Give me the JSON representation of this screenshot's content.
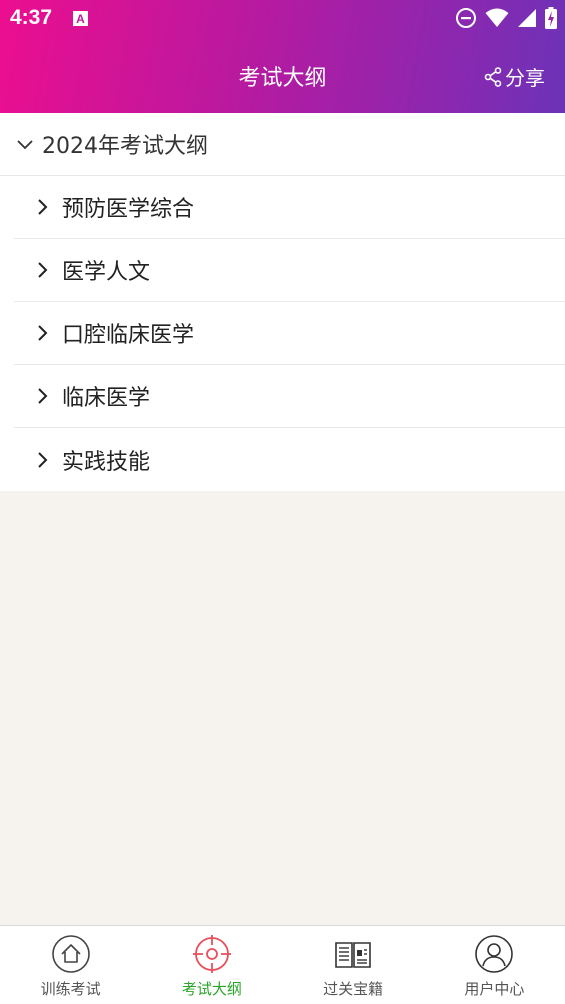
{
  "status": {
    "time": "4:37"
  },
  "header": {
    "title": "考试大纲",
    "share_label": "分享"
  },
  "outline": {
    "group_title": "2024年考试大纲",
    "items": [
      {
        "label": "预防医学综合"
      },
      {
        "label": "医学人文"
      },
      {
        "label": "口腔临床医学"
      },
      {
        "label": "临床医学"
      },
      {
        "label": "实践技能"
      }
    ]
  },
  "tabbar": {
    "tabs": [
      {
        "label": "训练考试",
        "icon": "home-icon"
      },
      {
        "label": "考试大纲",
        "icon": "target-icon"
      },
      {
        "label": "过关宝籍",
        "icon": "book-icon"
      },
      {
        "label": "用户中心",
        "icon": "user-icon"
      }
    ],
    "active_index": 1
  },
  "colors": {
    "header_gradient_start": "#ec0e8f",
    "header_gradient_end": "#6b33b8",
    "active_tab": "#2aa52a",
    "active_icon": "#e8505b",
    "background": "#f6f3ee"
  }
}
